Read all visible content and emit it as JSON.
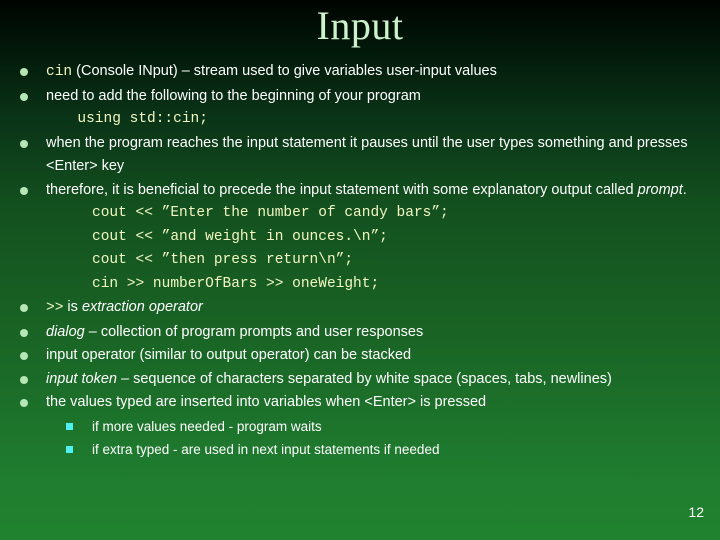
{
  "slide": {
    "title": "Input",
    "page_number": "12",
    "colors": {
      "title_text": "#cdf3cd",
      "body_text": "#ffffff",
      "code_text": "#f2f7c2",
      "bullet_level1": "#b6e6b6",
      "bullet_level2": "#4ff0ef",
      "background_top": "#000400",
      "background_bottom": "#20822f"
    },
    "bullets": [
      {
        "level": 1,
        "marker": "circle-bullet",
        "segments": [
          {
            "text": "cin",
            "style": "code"
          },
          {
            "text": " (Console INput) – stream used to give variables user-input values",
            "style": "normal"
          }
        ]
      },
      {
        "level": 1,
        "marker": "circle-bullet",
        "segments": [
          {
            "text": "need to add the following to the beginning of your program",
            "style": "normal"
          }
        ],
        "code_lines": [
          {
            "text": "  using std::cin;",
            "indent": "code"
          }
        ]
      },
      {
        "level": 1,
        "marker": "circle-bullet",
        "segments": [
          {
            "text": "when the program reaches the input statement it pauses until the user types something and presses <Enter> key",
            "style": "normal"
          }
        ]
      },
      {
        "level": 1,
        "marker": "circle-bullet",
        "segments": [
          {
            "text": "therefore, it is beneficial to precede the input statement with some explanatory output called ",
            "style": "normal"
          },
          {
            "text": "prompt",
            "style": "italic"
          },
          {
            "text": ".",
            "style": "normal"
          }
        ],
        "code_lines": [
          {
            "text": "cout << ”Enter the number of candy bars”;",
            "indent": "code2"
          },
          {
            "text": "cout << ”and weight in ounces.\\n”;",
            "indent": "code2"
          },
          {
            "text": "cout << ”then press return\\n”;",
            "indent": "code2"
          },
          {
            "text": "cin >> numberOfBars >> oneWeight;",
            "indent": "code2"
          }
        ]
      },
      {
        "level": 1,
        "marker": "circle-bullet",
        "segments": [
          {
            "text": ">>",
            "style": "code"
          },
          {
            "text": " is ",
            "style": "normal"
          },
          {
            "text": "extraction operator",
            "style": "italic"
          }
        ]
      },
      {
        "level": 1,
        "marker": "circle-bullet",
        "segments": [
          {
            "text": "dialog",
            "style": "italic"
          },
          {
            "text": " – collection of program prompts and user responses",
            "style": "normal"
          }
        ]
      },
      {
        "level": 1,
        "marker": "circle-bullet",
        "segments": [
          {
            "text": "input operator (similar to output operator) can be stacked",
            "style": "normal"
          }
        ]
      },
      {
        "level": 1,
        "marker": "circle-bullet",
        "segments": [
          {
            "text": "input token",
            "style": "italic"
          },
          {
            "text": " – sequence of characters separated by white space (spaces, tabs, newlines)",
            "style": "normal"
          }
        ]
      },
      {
        "level": 1,
        "marker": "circle-bullet",
        "segments": [
          {
            "text": "the values typed are inserted into variables when <Enter> is pressed",
            "style": "normal"
          }
        ]
      },
      {
        "level": 2,
        "marker": "square-bullet",
        "segments": [
          {
            "text": "if more values needed - program waits",
            "style": "normal"
          }
        ]
      },
      {
        "level": 2,
        "marker": "square-bullet",
        "segments": [
          {
            "text": "if extra typed - are used in next input statements if needed",
            "style": "normal"
          }
        ]
      }
    ]
  }
}
